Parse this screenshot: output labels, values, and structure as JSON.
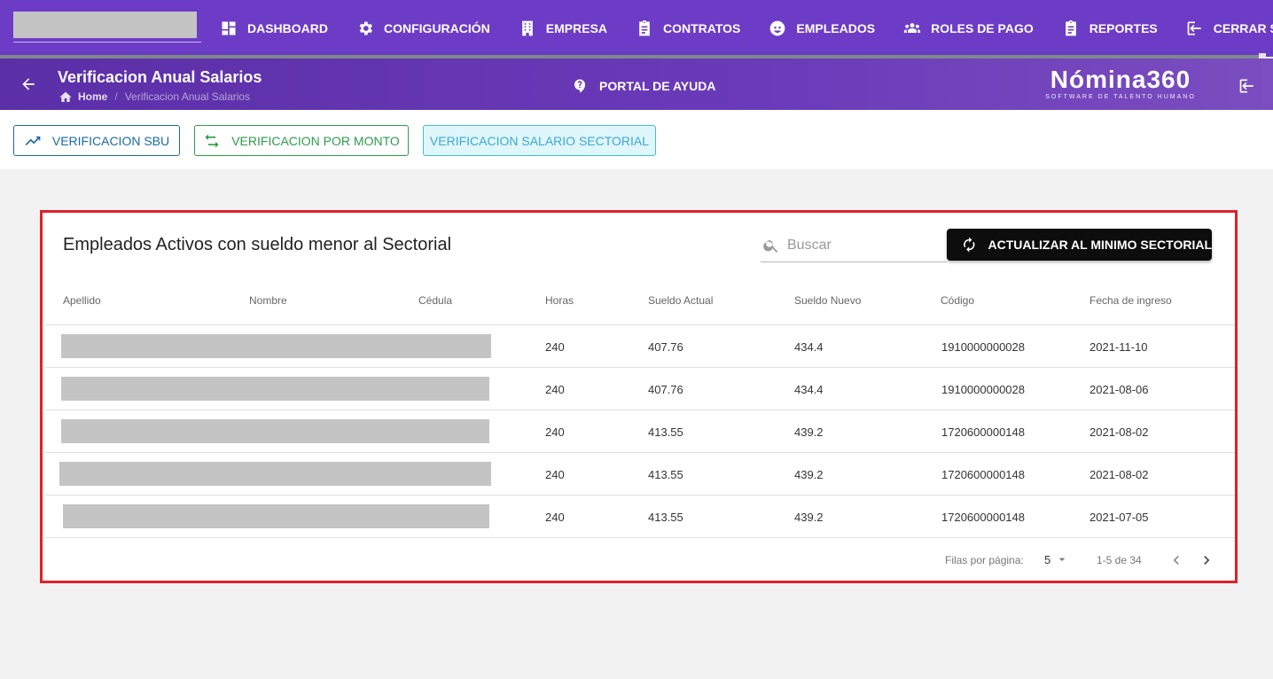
{
  "nav": {
    "items": [
      {
        "label": "DASHBOARD",
        "icon": "dashboard-icon"
      },
      {
        "label": "CONFIGURACIÓN",
        "icon": "gear-icon"
      },
      {
        "label": "EMPRESA",
        "icon": "building-icon"
      },
      {
        "label": "CONTRATOS",
        "icon": "clipboard-icon"
      },
      {
        "label": "EMPLEADOS",
        "icon": "face-icon"
      },
      {
        "label": "ROLES DE PAGO",
        "icon": "group-icon"
      },
      {
        "label": "REPORTES",
        "icon": "clipboard-icon"
      },
      {
        "label": "CERRAR SESIÓN",
        "icon": "logout-icon"
      }
    ]
  },
  "header": {
    "title": "Verificacion Anual Salarios",
    "breadcrumb_home": "Home",
    "breadcrumb_sep": "/",
    "breadcrumb_current": "Verificacion Anual Salarios",
    "help_label": "PORTAL DE AYUDA",
    "brand_name": "Nómina360",
    "brand_tagline": "SOFTWARE DE TALENTO HUMANO"
  },
  "toolbar": {
    "sbu_label": "VERIFICACION SBU",
    "monto_label": "VERIFICACION POR MONTO",
    "sectorial_label": "VERIFICACION SALARIO SECTORIAL"
  },
  "card": {
    "title": "Empleados Activos con sueldo menor al Sectorial",
    "search_placeholder": "Buscar",
    "update_label": "ACTUALIZAR AL MINIMO SECTORIAL"
  },
  "table": {
    "headers": {
      "apellido": "Apellido",
      "nombre": "Nombre",
      "cedula": "Cédula",
      "horas": "Horas",
      "sueldo_actual": "Sueldo Actual",
      "sueldo_nuevo": "Sueldo Nuevo",
      "codigo": "Código",
      "fecha": "Fecha de ingreso"
    },
    "rows": [
      {
        "horas": "240",
        "sueldo_actual": "407.76",
        "sueldo_nuevo": "434.4",
        "codigo": "1910000000028",
        "fecha": "2021-11-10"
      },
      {
        "horas": "240",
        "sueldo_actual": "407.76",
        "sueldo_nuevo": "434.4",
        "codigo": "1910000000028",
        "fecha": "2021-08-06"
      },
      {
        "horas": "240",
        "sueldo_actual": "413.55",
        "sueldo_nuevo": "439.2",
        "codigo": "1720600000148",
        "fecha": "2021-08-02"
      },
      {
        "horas": "240",
        "sueldo_actual": "413.55",
        "sueldo_nuevo": "439.2",
        "codigo": "1720600000148",
        "fecha": "2021-08-02"
      },
      {
        "horas": "240",
        "sueldo_actual": "413.55",
        "sueldo_nuevo": "439.2",
        "codigo": "1720600000148",
        "fecha": "2021-07-05"
      }
    ]
  },
  "pagination": {
    "rows_label": "Filas por página:",
    "rows_value": "5",
    "range": "1-5 de 34"
  },
  "colors": {
    "nav_bg": "#6c3cc6",
    "highlight_border": "#e0202c"
  }
}
